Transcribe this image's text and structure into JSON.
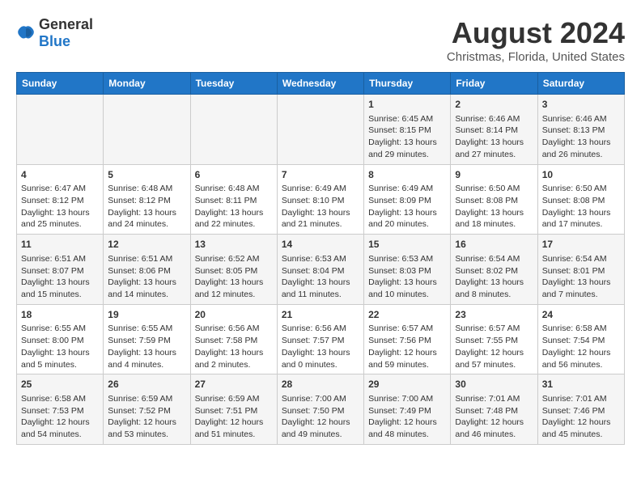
{
  "logo": {
    "general": "General",
    "blue": "Blue"
  },
  "title": "August 2024",
  "subtitle": "Christmas, Florida, United States",
  "days_of_week": [
    "Sunday",
    "Monday",
    "Tuesday",
    "Wednesday",
    "Thursday",
    "Friday",
    "Saturday"
  ],
  "weeks": [
    {
      "days": [
        {
          "number": "",
          "content": ""
        },
        {
          "number": "",
          "content": ""
        },
        {
          "number": "",
          "content": ""
        },
        {
          "number": "",
          "content": ""
        },
        {
          "number": "1",
          "content": "Sunrise: 6:45 AM\nSunset: 8:15 PM\nDaylight: 13 hours\nand 29 minutes."
        },
        {
          "number": "2",
          "content": "Sunrise: 6:46 AM\nSunset: 8:14 PM\nDaylight: 13 hours\nand 27 minutes."
        },
        {
          "number": "3",
          "content": "Sunrise: 6:46 AM\nSunset: 8:13 PM\nDaylight: 13 hours\nand 26 minutes."
        }
      ]
    },
    {
      "days": [
        {
          "number": "4",
          "content": "Sunrise: 6:47 AM\nSunset: 8:12 PM\nDaylight: 13 hours\nand 25 minutes."
        },
        {
          "number": "5",
          "content": "Sunrise: 6:48 AM\nSunset: 8:12 PM\nDaylight: 13 hours\nand 24 minutes."
        },
        {
          "number": "6",
          "content": "Sunrise: 6:48 AM\nSunset: 8:11 PM\nDaylight: 13 hours\nand 22 minutes."
        },
        {
          "number": "7",
          "content": "Sunrise: 6:49 AM\nSunset: 8:10 PM\nDaylight: 13 hours\nand 21 minutes."
        },
        {
          "number": "8",
          "content": "Sunrise: 6:49 AM\nSunset: 8:09 PM\nDaylight: 13 hours\nand 20 minutes."
        },
        {
          "number": "9",
          "content": "Sunrise: 6:50 AM\nSunset: 8:08 PM\nDaylight: 13 hours\nand 18 minutes."
        },
        {
          "number": "10",
          "content": "Sunrise: 6:50 AM\nSunset: 8:08 PM\nDaylight: 13 hours\nand 17 minutes."
        }
      ]
    },
    {
      "days": [
        {
          "number": "11",
          "content": "Sunrise: 6:51 AM\nSunset: 8:07 PM\nDaylight: 13 hours\nand 15 minutes."
        },
        {
          "number": "12",
          "content": "Sunrise: 6:51 AM\nSunset: 8:06 PM\nDaylight: 13 hours\nand 14 minutes."
        },
        {
          "number": "13",
          "content": "Sunrise: 6:52 AM\nSunset: 8:05 PM\nDaylight: 13 hours\nand 12 minutes."
        },
        {
          "number": "14",
          "content": "Sunrise: 6:53 AM\nSunset: 8:04 PM\nDaylight: 13 hours\nand 11 minutes."
        },
        {
          "number": "15",
          "content": "Sunrise: 6:53 AM\nSunset: 8:03 PM\nDaylight: 13 hours\nand 10 minutes."
        },
        {
          "number": "16",
          "content": "Sunrise: 6:54 AM\nSunset: 8:02 PM\nDaylight: 13 hours\nand 8 minutes."
        },
        {
          "number": "17",
          "content": "Sunrise: 6:54 AM\nSunset: 8:01 PM\nDaylight: 13 hours\nand 7 minutes."
        }
      ]
    },
    {
      "days": [
        {
          "number": "18",
          "content": "Sunrise: 6:55 AM\nSunset: 8:00 PM\nDaylight: 13 hours\nand 5 minutes."
        },
        {
          "number": "19",
          "content": "Sunrise: 6:55 AM\nSunset: 7:59 PM\nDaylight: 13 hours\nand 4 minutes."
        },
        {
          "number": "20",
          "content": "Sunrise: 6:56 AM\nSunset: 7:58 PM\nDaylight: 13 hours\nand 2 minutes."
        },
        {
          "number": "21",
          "content": "Sunrise: 6:56 AM\nSunset: 7:57 PM\nDaylight: 13 hours\nand 0 minutes."
        },
        {
          "number": "22",
          "content": "Sunrise: 6:57 AM\nSunset: 7:56 PM\nDaylight: 12 hours\nand 59 minutes."
        },
        {
          "number": "23",
          "content": "Sunrise: 6:57 AM\nSunset: 7:55 PM\nDaylight: 12 hours\nand 57 minutes."
        },
        {
          "number": "24",
          "content": "Sunrise: 6:58 AM\nSunset: 7:54 PM\nDaylight: 12 hours\nand 56 minutes."
        }
      ]
    },
    {
      "days": [
        {
          "number": "25",
          "content": "Sunrise: 6:58 AM\nSunset: 7:53 PM\nDaylight: 12 hours\nand 54 minutes."
        },
        {
          "number": "26",
          "content": "Sunrise: 6:59 AM\nSunset: 7:52 PM\nDaylight: 12 hours\nand 53 minutes."
        },
        {
          "number": "27",
          "content": "Sunrise: 6:59 AM\nSunset: 7:51 PM\nDaylight: 12 hours\nand 51 minutes."
        },
        {
          "number": "28",
          "content": "Sunrise: 7:00 AM\nSunset: 7:50 PM\nDaylight: 12 hours\nand 49 minutes."
        },
        {
          "number": "29",
          "content": "Sunrise: 7:00 AM\nSunset: 7:49 PM\nDaylight: 12 hours\nand 48 minutes."
        },
        {
          "number": "30",
          "content": "Sunrise: 7:01 AM\nSunset: 7:48 PM\nDaylight: 12 hours\nand 46 minutes."
        },
        {
          "number": "31",
          "content": "Sunrise: 7:01 AM\nSunset: 7:46 PM\nDaylight: 12 hours\nand 45 minutes."
        }
      ]
    }
  ]
}
